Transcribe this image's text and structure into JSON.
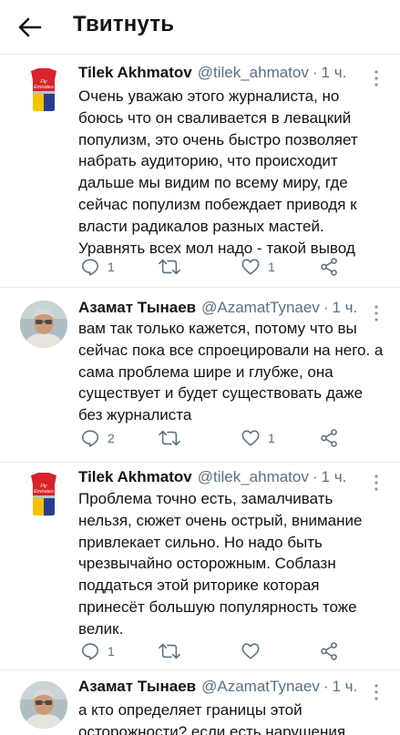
{
  "header": {
    "title": "Твитнуть",
    "back_icon": "arrow-left-icon"
  },
  "tweets": [
    {
      "author": "Tilek Akhmatov",
      "handle": "@tilek_ahmatov",
      "separator": "·",
      "time": "1 ч.",
      "text": "Очень уважаю этого журналиста, но боюсь что он сваливается в левацкий популизм, это очень быстро позволяет набрать аудиторию, что происходит дальше мы видим по всему миру, где сейчас популизм побеждает приводя к власти радикалов разных мастей. Уравнять всех мол надо - такой вывод",
      "avatar_text": "Fly Emirates",
      "replies": "1",
      "retweets": "",
      "likes": "1"
    },
    {
      "author": "Азамат Тынаев",
      "handle": "@AzamatTynaev",
      "separator": "·",
      "time": "1 ч.",
      "text": "вам так только кажется, потому что вы сейчас пока все спроецировали на него. а сама проблема шире и глубже, она существует и будет существовать даже без журналиста",
      "replies": "2",
      "retweets": "",
      "likes": "1"
    },
    {
      "author": "Tilek Akhmatov",
      "handle": "@tilek_ahmatov",
      "separator": "·",
      "time": "1 ч.",
      "text": "Проблема точно есть, замалчивать нельзя, сюжет очень острый, внимание привлекает сильно. Но надо быть чрезвычайно осторожным. Соблазн поддаться этой риторике которая принесёт большую популярность тоже велик.",
      "avatar_text": "Fly Emirates",
      "replies": "1",
      "retweets": "",
      "likes": ""
    },
    {
      "author": "Азамат Тынаев",
      "handle": "@AzamatTynaev",
      "separator": "·",
      "time": "1 ч.",
      "text": "а кто определяет границы этой осторожности? если есть нарушения"
    }
  ],
  "colors": {
    "text": "#0f1419",
    "secondary": "#5b7083",
    "divider": "#e6ecf0",
    "jersey_red": "#d8232a",
    "jersey_yellow": "#f5c400",
    "jersey_blue": "#2a3c8f"
  }
}
